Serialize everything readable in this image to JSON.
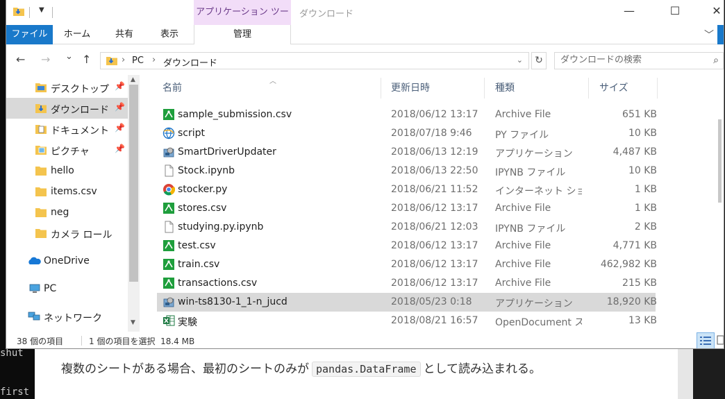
{
  "window": {
    "title": "ダウンロード",
    "contextual_tab_group": "アプリケーション ツール",
    "buttons": {
      "minimize": "—",
      "maximize": "☐",
      "close": "✕"
    }
  },
  "ribbon": {
    "tabs": [
      "ファイル",
      "ホーム",
      "共有",
      "表示",
      "管理"
    ],
    "expand_glyph": "﹀"
  },
  "navbar": {
    "back": "←",
    "forward": "→",
    "recent": "⌄",
    "up": "↑",
    "breadcrumb": [
      "PC",
      "ダウンロード"
    ],
    "separator": "›",
    "refresh": "↻",
    "search_placeholder": "ダウンロードの検索"
  },
  "navpane": {
    "items": [
      {
        "label": "デスクトップ",
        "icon": "desktop-folder-icon",
        "pinned": true
      },
      {
        "label": "ダウンロード",
        "icon": "download-folder-icon",
        "pinned": true,
        "selected": true
      },
      {
        "label": "ドキュメント",
        "icon": "documents-folder-icon",
        "pinned": true
      },
      {
        "label": "ピクチャ",
        "icon": "pictures-folder-icon",
        "pinned": true
      },
      {
        "label": "hello",
        "icon": "folder-icon"
      },
      {
        "label": "items.csv",
        "icon": "folder-icon"
      },
      {
        "label": "neg",
        "icon": "folder-icon"
      },
      {
        "label": "カメラ ロール",
        "icon": "folder-icon"
      },
      {
        "label": "OneDrive",
        "icon": "onedrive-cloud-icon"
      },
      {
        "label": "PC",
        "icon": "pc-icon"
      },
      {
        "label": "ネットワーク",
        "icon": "network-icon"
      }
    ],
    "pin_glyph": "📌"
  },
  "filelist": {
    "columns": {
      "name": "名前",
      "date": "更新日時",
      "type": "種類",
      "size": "サイズ"
    },
    "rows": [
      {
        "name": "sample_submission.csv",
        "date": "2018/06/12 13:17",
        "type": "Archive File",
        "size": "651 KB",
        "icon": "archive-csv-icon"
      },
      {
        "name": "script",
        "date": "2018/07/18 9:46",
        "type": "PY ファイル",
        "size": "10 KB",
        "icon": "python-script-icon"
      },
      {
        "name": "SmartDriverUpdater",
        "date": "2018/06/13 12:19",
        "type": "アプリケーション",
        "size": "4,487 KB",
        "icon": "application-installer-icon"
      },
      {
        "name": "Stock.ipynb",
        "date": "2018/06/13 22:50",
        "type": "IPYNB ファイル",
        "size": "10 KB",
        "icon": "blank-file-icon"
      },
      {
        "name": "stocker.py",
        "date": "2018/06/21 11:52",
        "type": "インターネット ショート",
        "size": "1 KB",
        "icon": "chrome-shortcut-icon"
      },
      {
        "name": "stores.csv",
        "date": "2018/06/12 13:17",
        "type": "Archive File",
        "size": "1 KB",
        "icon": "archive-csv-icon"
      },
      {
        "name": "studying.py.ipynb",
        "date": "2018/06/21 12:03",
        "type": "IPYNB ファイル",
        "size": "2 KB",
        "icon": "blank-file-icon"
      },
      {
        "name": "test.csv",
        "date": "2018/06/12 13:17",
        "type": "Archive File",
        "size": "4,771 KB",
        "icon": "archive-csv-icon"
      },
      {
        "name": "train.csv",
        "date": "2018/06/12 13:17",
        "type": "Archive File",
        "size": "462,982 KB",
        "icon": "archive-csv-icon"
      },
      {
        "name": "transactions.csv",
        "date": "2018/06/12 13:17",
        "type": "Archive File",
        "size": "215 KB",
        "icon": "archive-csv-icon"
      },
      {
        "name": "win-ts8130-1_1-n_jucd",
        "date": "2018/05/23 0:18",
        "type": "アプリケーション",
        "size": "18,920 KB",
        "icon": "application-installer-icon",
        "selected": true
      },
      {
        "name": "実験",
        "date": "2018/08/21 16:57",
        "type": "OpenDocument ス...",
        "size": "13 KB",
        "icon": "spreadsheet-icon"
      }
    ]
  },
  "statusbar": {
    "item_count": "38 個の項目",
    "selection": "1 個の項目を選択  18.4 MB"
  },
  "background": {
    "terminal_lines": [
      "shut",
      "first"
    ],
    "article_before": "複数のシートがある場合、最初のシートのみが",
    "article_code": "pandas.DataFrame",
    "article_after": "として読み込まれる。"
  },
  "colors": {
    "file_tab": "#1979ca",
    "contextual_tab": "#f2ddf8",
    "selection": "#d9d9d9",
    "header_text": "#4c607a",
    "folder_yellow": "#f4c44e"
  }
}
